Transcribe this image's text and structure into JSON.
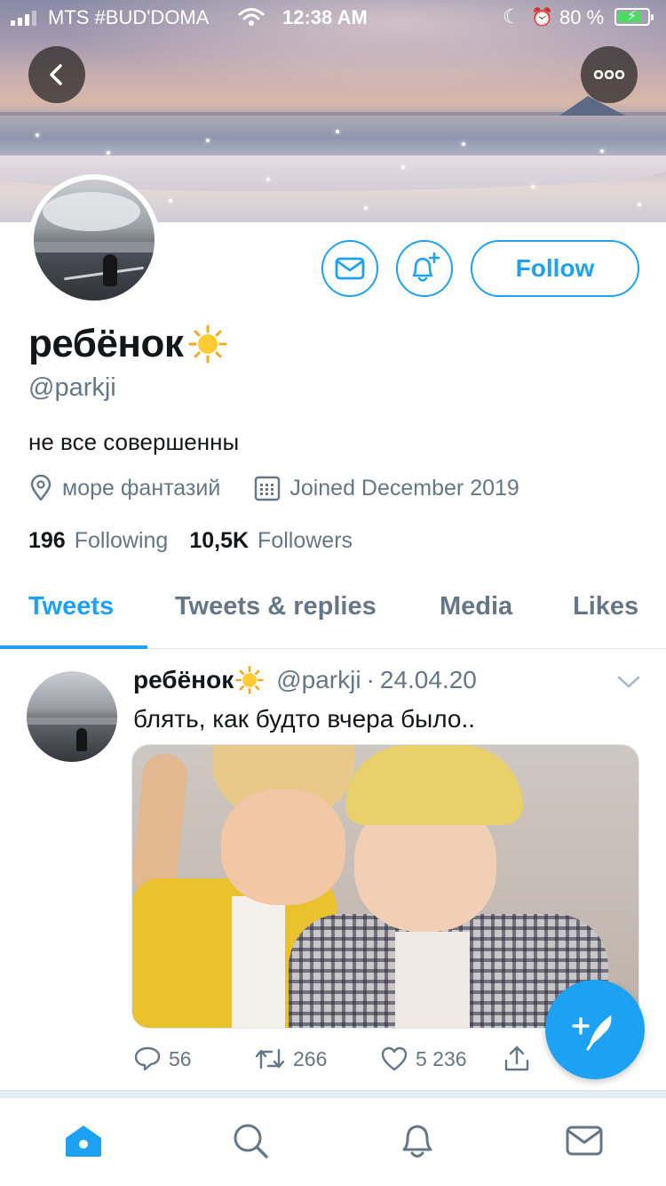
{
  "status_bar": {
    "carrier": "MTS #BUD'DOMA",
    "time": "12:38 AM",
    "battery_percent": "80 %",
    "battery_level": 0.8,
    "charging": true,
    "icons": [
      "signal-icon",
      "wifi-icon",
      "moon-icon",
      "alarm-icon",
      "battery-icon"
    ]
  },
  "header": {
    "back_icon": "chevron-left-icon",
    "more_icon": "more-horizontal-icon"
  },
  "profile": {
    "name": "ребёнок",
    "name_emoji_icon": "sun-icon",
    "handle": "@parkji",
    "bio": "не все совершенны",
    "location": "море фантазий",
    "joined": "Joined December 2019",
    "following_count": "196",
    "following_label": "Following",
    "followers_count": "10,5K",
    "followers_label": "Followers"
  },
  "actions": {
    "message_icon": "envelope-icon",
    "notify_icon": "bell-plus-icon",
    "follow_label": "Follow"
  },
  "tabs": [
    {
      "label": "Tweets",
      "active": true
    },
    {
      "label": "Tweets & replies",
      "active": false
    },
    {
      "label": "Media",
      "active": false
    },
    {
      "label": "Likes",
      "active": false
    }
  ],
  "tweet": {
    "author_name": "ребёнок",
    "author_handle": "@parkji",
    "separator": "·",
    "date": "24.04.20",
    "text": "блять, как будто вчера было..",
    "reply_count": "56",
    "retweet_count": "266",
    "like_count": "5 236"
  },
  "fab": {
    "icon": "compose-tweet-icon"
  },
  "bottom_nav": [
    {
      "icon": "home-icon",
      "active": true
    },
    {
      "icon": "search-icon",
      "active": false
    },
    {
      "icon": "bell-icon",
      "active": false
    },
    {
      "icon": "envelope-icon",
      "active": false
    }
  ],
  "colors": {
    "accent": "#1da1f2",
    "text_primary": "#14171a",
    "text_secondary": "#657786",
    "divider": "#e1e8ed",
    "battery_green": "#4cd964"
  }
}
